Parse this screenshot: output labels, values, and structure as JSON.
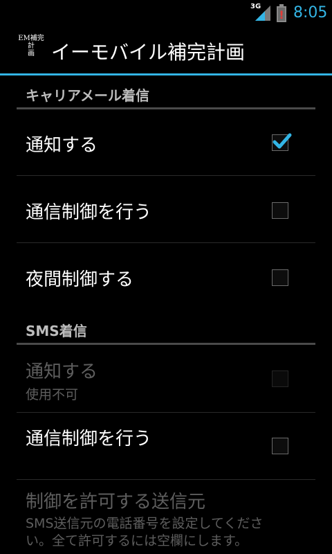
{
  "status_bar": {
    "network_type": "3G",
    "time": "8:05",
    "battery_alert": "!"
  },
  "action_bar": {
    "icon_line1": "EM補完",
    "icon_line2": "計",
    "icon_line3": "画",
    "title": "イーモバイル補完計画"
  },
  "sections": [
    {
      "header": "キャリアメール着信",
      "items": [
        {
          "title": "通知する",
          "checked": true,
          "enabled": true
        },
        {
          "title": "通信制御を行う",
          "checked": false,
          "enabled": true
        },
        {
          "title": "夜間制御する",
          "checked": false,
          "enabled": true
        }
      ]
    },
    {
      "header": "SMS着信",
      "items": [
        {
          "title": "通知する",
          "summary": "使用不可",
          "checked": false,
          "enabled": false
        },
        {
          "title": "通信制御を行う",
          "checked": false,
          "enabled": true
        }
      ]
    }
  ],
  "sender_pref": {
    "title": "制御を許可する送信元",
    "summary_line1": "SMS送信元の電話番号を設定してくださ",
    "summary_line2": "い。全て許可するには空欄にします。"
  },
  "colors": {
    "accent": "#33b5e5",
    "background": "#000000",
    "category_text": "#bdbdbd",
    "disabled_text": "#5e5e5e"
  }
}
